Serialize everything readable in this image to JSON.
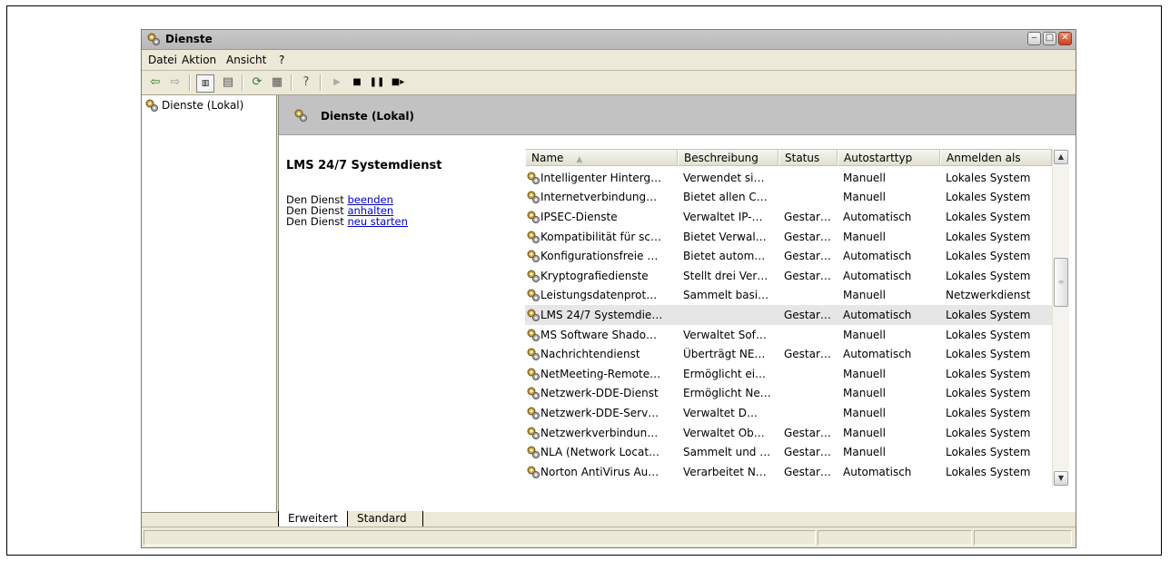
{
  "window": {
    "title": "Dienste"
  },
  "menu": [
    {
      "label": "Datei"
    },
    {
      "label": "Aktion"
    },
    {
      "label": "Ansicht"
    },
    {
      "label": "?"
    }
  ],
  "toolbar": {
    "icons": [
      "back-arrow-icon",
      "forward-arrow-icon",
      "show-hide-tree-icon",
      "properties-icon",
      "refresh-icon",
      "export-list-icon",
      "help-icon",
      "start-service-icon",
      "stop-service-icon",
      "pause-service-icon",
      "restart-service-icon"
    ]
  },
  "tree": {
    "root_label": "Dienste (Lokal)"
  },
  "pane": {
    "header": "Dienste (Lokal)"
  },
  "details": {
    "title": "LMS 24/7 Systemdienst",
    "prefix": "Den Dienst ",
    "actions": [
      "beenden",
      "anhalten",
      "neu starten"
    ]
  },
  "list": {
    "columns": [
      "Name",
      "Beschreibung",
      "Status",
      "Autostarttyp",
      "Anmelden als"
    ],
    "rows": [
      {
        "name": "Intelligenter Hinterg…",
        "desc": "Verwendet si…",
        "status": "",
        "auto": "Manuell",
        "logon": "Lokales System"
      },
      {
        "name": "Internetverbindung…",
        "desc": "Bietet allen C…",
        "status": "",
        "auto": "Manuell",
        "logon": "Lokales System"
      },
      {
        "name": "IPSEC-Dienste",
        "desc": "Verwaltet IP-…",
        "status": "Gestar…",
        "auto": "Automatisch",
        "logon": "Lokales System"
      },
      {
        "name": "Kompatibilität für sc…",
        "desc": "Bietet Verwal…",
        "status": "Gestar…",
        "auto": "Manuell",
        "logon": "Lokales System"
      },
      {
        "name": "Konfigurationsfreie …",
        "desc": "Bietet autom…",
        "status": "Gestar…",
        "auto": "Automatisch",
        "logon": "Lokales System"
      },
      {
        "name": "Kryptografiedienste",
        "desc": "Stellt drei Ver…",
        "status": "Gestar…",
        "auto": "Automatisch",
        "logon": "Lokales System"
      },
      {
        "name": "Leistungsdatenprot…",
        "desc": "Sammelt basi…",
        "status": "",
        "auto": "Manuell",
        "logon": "Netzwerkdienst"
      },
      {
        "name": "LMS 24/7 Systemdie…",
        "desc": "",
        "status": "Gestar…",
        "auto": "Automatisch",
        "logon": "Lokales System",
        "selected": true
      },
      {
        "name": "MS Software Shado…",
        "desc": "Verwaltet Sof…",
        "status": "",
        "auto": "Manuell",
        "logon": "Lokales System"
      },
      {
        "name": "Nachrichtendienst",
        "desc": "Überträgt NE…",
        "status": "Gestar…",
        "auto": "Automatisch",
        "logon": "Lokales System"
      },
      {
        "name": "NetMeeting-Remote…",
        "desc": "Ermöglicht ei…",
        "status": "",
        "auto": "Manuell",
        "logon": "Lokales System"
      },
      {
        "name": "Netzwerk-DDE-Dienst",
        "desc": "Ermöglicht Ne…",
        "status": "",
        "auto": "Manuell",
        "logon": "Lokales System"
      },
      {
        "name": "Netzwerk-DDE-Serv…",
        "desc": "Verwaltet D…",
        "status": "",
        "auto": "Manuell",
        "logon": "Lokales System"
      },
      {
        "name": "Netzwerkverbindun…",
        "desc": "Verwaltet Ob…",
        "status": "Gestar…",
        "auto": "Manuell",
        "logon": "Lokales System"
      },
      {
        "name": "NLA (Network Locat…",
        "desc": "Sammelt und …",
        "status": "Gestar…",
        "auto": "Manuell",
        "logon": "Lokales System"
      },
      {
        "name": "Norton AntiVirus Au…",
        "desc": "Verarbeitet N…",
        "status": "Gestar…",
        "auto": "Automatisch",
        "logon": "Lokales System"
      }
    ]
  },
  "tabs": [
    "Erweitert",
    "Standard"
  ]
}
